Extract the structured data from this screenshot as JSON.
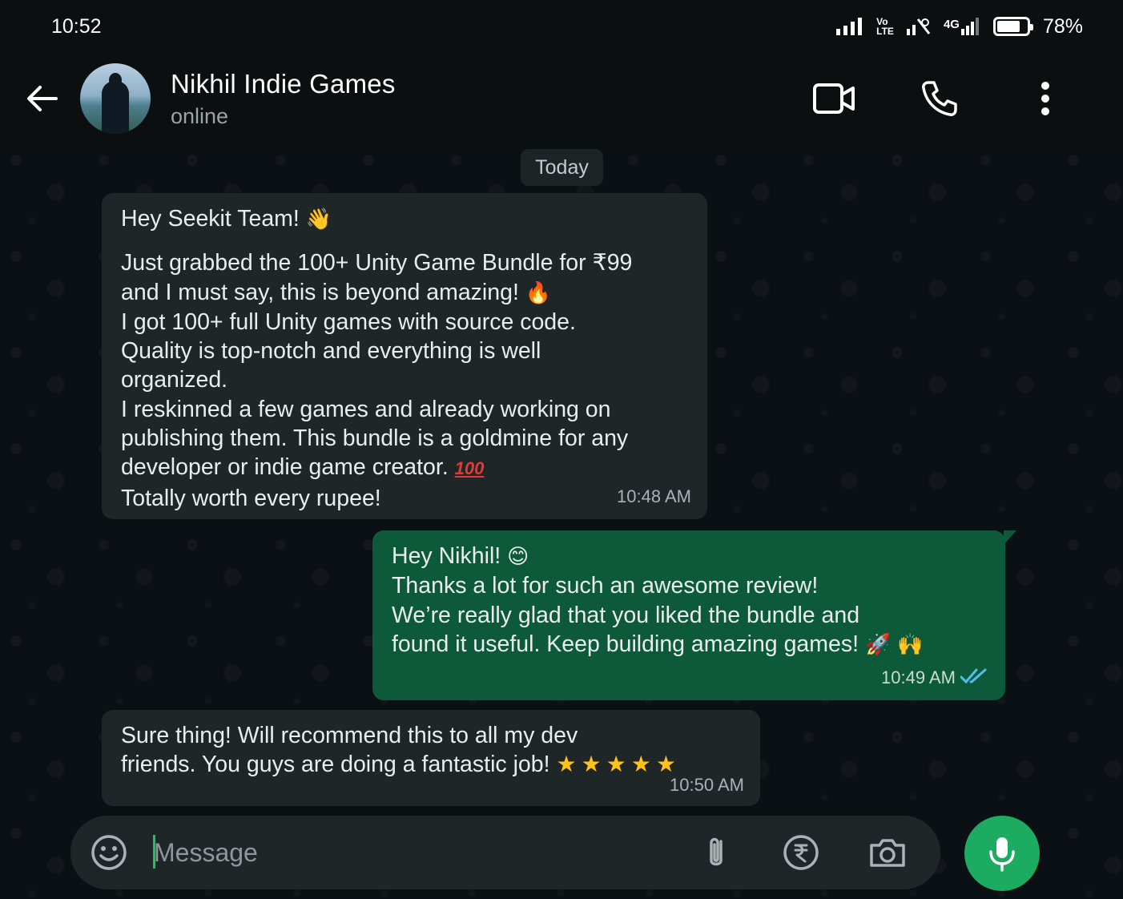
{
  "status_bar": {
    "time": "10:52",
    "battery_percent": "78%",
    "battery_level": 0.78,
    "network_label": "4G",
    "volte_label_top": "Vo",
    "volte_label_bottom": "LTE"
  },
  "header": {
    "contact_name": "Nikhil Indie Games",
    "contact_status": "online",
    "icons": [
      "back-arrow-icon",
      "video-call-icon",
      "voice-call-icon",
      "more-options-icon"
    ]
  },
  "chat": {
    "date_chip": "Today",
    "messages": [
      {
        "direction": "incoming",
        "greeting": "Hey Seekit Team! ",
        "greeting_emoji": "👋",
        "lines": [
          "Just grabbed the 100+ Unity Game Bundle for ₹99",
          "and I must say, this is beyond amazing! ",
          "I got 100+ full Unity games with source code.",
          "Quality is top-notch and everything is well",
          "organized.",
          "I reskinned a few games and already working on",
          "publishing them. This bundle is a goldmine for any",
          "developer or indie game creator. ",
          "Totally worth every rupee!"
        ],
        "fire_emoji": "🔥",
        "hundred_emoji": "100",
        "time": "10:48 AM"
      },
      {
        "direction": "outgoing",
        "lines": [
          "Hey Nikhil! ",
          "Thanks a lot for such an awesome review!",
          "We’re really glad that you liked the bundle and",
          "found it useful. Keep building amazing games! "
        ],
        "smile_emoji": "😊",
        "rocket_emoji": "🚀",
        "hands_emoji": "🙌",
        "time": "10:49 AM",
        "read_status": "read",
        "tick_color": "#53bdeb"
      },
      {
        "direction": "incoming",
        "lines": [
          "Sure thing! Will recommend this to all my dev",
          "friends. You guys are doing a fantastic job! "
        ],
        "stars": "★★★★★",
        "time": "10:50 AM"
      }
    ]
  },
  "composer": {
    "placeholder": "Message",
    "value": "",
    "icons": [
      "emoji-icon",
      "attach-icon",
      "rupee-payment-icon",
      "camera-icon",
      "mic-icon"
    ]
  },
  "colors": {
    "background": "#0b0f10",
    "incoming_bubble": "#1f2628",
    "outgoing_bubble": "#0c5a39",
    "accent_green": "#1daa61",
    "read_ticks": "#53bdeb",
    "star": "#ffc21a"
  }
}
